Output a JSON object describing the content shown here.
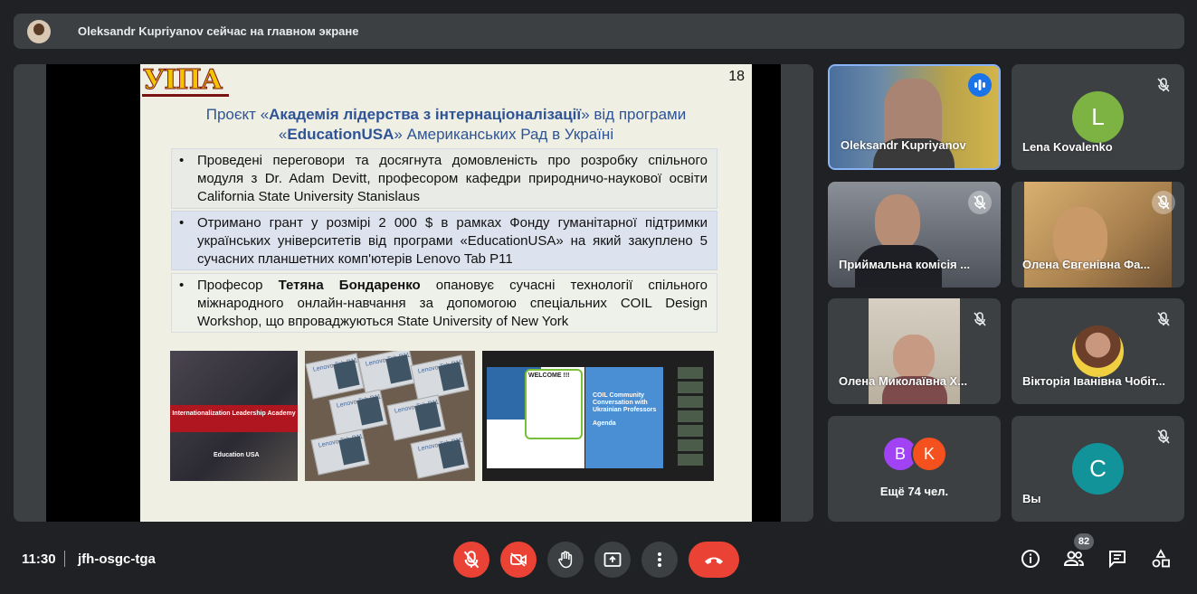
{
  "banner": {
    "text": "Oleksandr Kupriyanov сейчас на главном экране"
  },
  "slide": {
    "logo": "УІПА",
    "number": "18",
    "title_pre": "Проєкт «",
    "title_bold1": "Академія лідерства з інтернаціоналізації",
    "title_mid": "» від програми «",
    "title_bold2": "EducationUSA",
    "title_post": "» Американських Рад в Україні",
    "bullet1": "Проведені переговори та досягнута домовленість про розробку спільного модуля з Dr. Adam Devitt, професором кафедри природничо-наукової освіти California State University Stanislaus",
    "bullet2": "Отримано грант у розмірі 2 000 $ в рамках Фонду гуманітарної підтримки українських університетів від програми «EducationUSA» на який закуплено 5 сучасних планшетних комп'ютерів Lenovo Tab P11",
    "bullet3_pre": "Професор ",
    "bullet3_bold": "Тетяна Бондаренко",
    "bullet3_post": " опановує сучасні технології спільного міжнародного онлайн-навчання за допомогою спеціальних COIL Design Workshop, що впроваджуються State University of New York",
    "img1_banner": "Internationalization Leadership Academy",
    "img1_logo": "Education USA",
    "img2_label": "Lenovo Tab P11",
    "img3_welcome": "WELCOME !!!",
    "img3_title": "COIL Community Conversation with Ukrainian Professors",
    "img3_agenda": "Agenda"
  },
  "participants": [
    {
      "name": "Oleksandr Kupriyanov",
      "speaking": true
    },
    {
      "name": "Lena Kovalenko",
      "initial": "L",
      "color": "#7cb342"
    },
    {
      "name": "Приймальна комісія ..."
    },
    {
      "name": "Олена Євгенівна Фа..."
    },
    {
      "name": "Олена Миколаївна Х..."
    },
    {
      "name": "Вікторія Іванівна Чобіт..."
    },
    {
      "name": "Ещё 74 чел.",
      "initials": [
        "B",
        "K"
      ],
      "colors": [
        "#a142f4",
        "#f4511e"
      ]
    },
    {
      "name": "Вы",
      "initial": "C",
      "color": "#12939a"
    }
  ],
  "bottom": {
    "time": "11:30",
    "meeting_code": "jfh-osgc-tga",
    "people_count": "82"
  },
  "icons": [
    "mic-off-icon",
    "camera-off-icon",
    "raise-hand-icon",
    "present-icon",
    "more-icon",
    "hang-up-icon",
    "info-icon",
    "people-icon",
    "chat-icon",
    "activities-icon"
  ]
}
